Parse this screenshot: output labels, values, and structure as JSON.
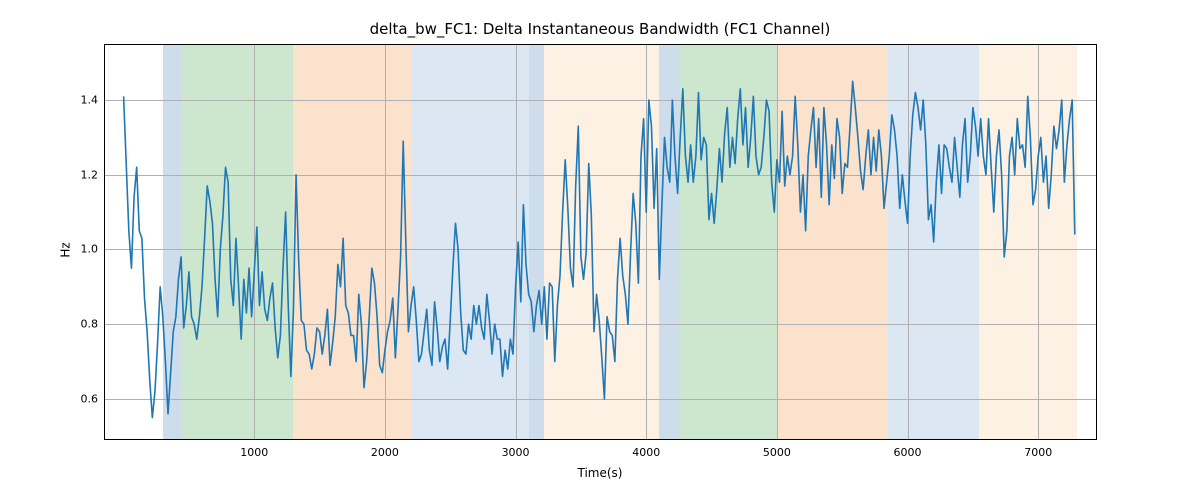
{
  "chart_data": {
    "type": "line",
    "title": "delta_bw_FC1: Delta Instantaneous Bandwidth (FC1 Channel)",
    "xlabel": "Time(s)",
    "ylabel": "Hz",
    "xlim": [
      -150,
      7450
    ],
    "ylim": [
      0.49,
      1.55
    ],
    "y_ticks": [
      0.6,
      0.8,
      1.0,
      1.2,
      1.4
    ],
    "x_ticks": [
      1000,
      2000,
      3000,
      4000,
      5000,
      6000,
      7000
    ],
    "regions": [
      {
        "start": 300,
        "end": 450,
        "color": "#6596c4"
      },
      {
        "start": 450,
        "end": 1300,
        "color": "#64b366"
      },
      {
        "start": 1300,
        "end": 2200,
        "color": "#f4a460"
      },
      {
        "start": 2200,
        "end": 3100,
        "color": "#8fb4d9"
      },
      {
        "start": 3100,
        "end": 3220,
        "color": "#6596c4"
      },
      {
        "start": 3220,
        "end": 4100,
        "color": "#f9d2a8"
      },
      {
        "start": 4100,
        "end": 4260,
        "color": "#6596c4"
      },
      {
        "start": 4260,
        "end": 5000,
        "color": "#64b366"
      },
      {
        "start": 5000,
        "end": 5850,
        "color": "#f4a460"
      },
      {
        "start": 5850,
        "end": 6550,
        "color": "#8fb4d9"
      },
      {
        "start": 6550,
        "end": 7300,
        "color": "#f9d2a8"
      }
    ],
    "x": [
      0,
      20,
      40,
      60,
      80,
      100,
      120,
      140,
      160,
      180,
      200,
      220,
      240,
      260,
      280,
      300,
      320,
      340,
      360,
      380,
      400,
      420,
      440,
      460,
      480,
      500,
      520,
      540,
      560,
      580,
      600,
      620,
      640,
      660,
      680,
      700,
      720,
      740,
      760,
      780,
      800,
      820,
      840,
      860,
      880,
      900,
      920,
      940,
      960,
      980,
      1000,
      1020,
      1040,
      1060,
      1080,
      1100,
      1120,
      1140,
      1160,
      1180,
      1200,
      1220,
      1240,
      1260,
      1280,
      1300,
      1320,
      1340,
      1360,
      1380,
      1400,
      1420,
      1440,
      1460,
      1480,
      1500,
      1520,
      1540,
      1560,
      1580,
      1600,
      1620,
      1640,
      1660,
      1680,
      1700,
      1720,
      1740,
      1760,
      1780,
      1800,
      1820,
      1840,
      1860,
      1880,
      1900,
      1920,
      1940,
      1960,
      1980,
      2000,
      2020,
      2040,
      2060,
      2080,
      2100,
      2120,
      2140,
      2160,
      2180,
      2200,
      2220,
      2240,
      2260,
      2280,
      2300,
      2320,
      2340,
      2360,
      2380,
      2400,
      2420,
      2440,
      2460,
      2480,
      2500,
      2520,
      2540,
      2560,
      2580,
      2600,
      2620,
      2640,
      2660,
      2680,
      2700,
      2720,
      2740,
      2760,
      2780,
      2800,
      2820,
      2840,
      2860,
      2880,
      2900,
      2920,
      2940,
      2960,
      2980,
      3000,
      3020,
      3040,
      3060,
      3080,
      3100,
      3120,
      3140,
      3160,
      3180,
      3200,
      3220,
      3240,
      3260,
      3280,
      3300,
      3320,
      3340,
      3360,
      3380,
      3400,
      3420,
      3440,
      3460,
      3480,
      3500,
      3520,
      3540,
      3560,
      3580,
      3600,
      3620,
      3640,
      3660,
      3680,
      3700,
      3720,
      3740,
      3760,
      3780,
      3800,
      3820,
      3840,
      3860,
      3880,
      3900,
      3920,
      3940,
      3960,
      3980,
      4000,
      4020,
      4040,
      4060,
      4080,
      4100,
      4120,
      4140,
      4160,
      4180,
      4200,
      4220,
      4240,
      4260,
      4280,
      4300,
      4320,
      4340,
      4360,
      4380,
      4400,
      4420,
      4440,
      4460,
      4480,
      4500,
      4520,
      4540,
      4560,
      4580,
      4600,
      4620,
      4640,
      4660,
      4680,
      4700,
      4720,
      4740,
      4760,
      4780,
      4800,
      4820,
      4840,
      4860,
      4880,
      4900,
      4920,
      4940,
      4960,
      4980,
      5000,
      5020,
      5040,
      5060,
      5080,
      5100,
      5120,
      5140,
      5160,
      5180,
      5200,
      5220,
      5240,
      5260,
      5280,
      5300,
      5320,
      5340,
      5360,
      5380,
      5400,
      5420,
      5440,
      5460,
      5480,
      5500,
      5520,
      5540,
      5560,
      5580,
      5600,
      5620,
      5640,
      5660,
      5680,
      5700,
      5720,
      5740,
      5760,
      5780,
      5800,
      5820,
      5840,
      5860,
      5880,
      5900,
      5920,
      5940,
      5960,
      5980,
      6000,
      6020,
      6040,
      6060,
      6080,
      6100,
      6120,
      6140,
      6160,
      6180,
      6200,
      6220,
      6240,
      6260,
      6280,
      6300,
      6320,
      6340,
      6360,
      6380,
      6400,
      6420,
      6440,
      6460,
      6480,
      6500,
      6520,
      6540,
      6560,
      6580,
      6600,
      6620,
      6640,
      6660,
      6680,
      6700,
      6720,
      6740,
      6760,
      6780,
      6800,
      6820,
      6840,
      6860,
      6880,
      6900,
      6920,
      6940,
      6960,
      6980,
      7000,
      7020,
      7040,
      7060,
      7080,
      7100,
      7120,
      7140,
      7160,
      7180,
      7200,
      7220,
      7240,
      7260,
      7280
    ],
    "values": [
      1.41,
      1.23,
      1.05,
      0.95,
      1.14,
      1.22,
      1.05,
      1.03,
      0.87,
      0.78,
      0.65,
      0.55,
      0.62,
      0.75,
      0.9,
      0.82,
      0.7,
      0.56,
      0.67,
      0.78,
      0.82,
      0.92,
      0.98,
      0.79,
      0.85,
      0.94,
      0.82,
      0.8,
      0.76,
      0.82,
      0.9,
      1.03,
      1.17,
      1.13,
      1.07,
      0.92,
      0.82,
      1.0,
      1.09,
      1.22,
      1.18,
      0.92,
      0.85,
      1.03,
      0.9,
      0.76,
      0.92,
      0.83,
      0.95,
      0.82,
      0.94,
      1.06,
      0.85,
      0.94,
      0.84,
      0.81,
      0.87,
      0.91,
      0.79,
      0.71,
      0.77,
      0.95,
      1.1,
      0.85,
      0.66,
      0.84,
      1.2,
      0.97,
      0.81,
      0.8,
      0.73,
      0.72,
      0.68,
      0.72,
      0.79,
      0.78,
      0.72,
      0.77,
      0.84,
      0.69,
      0.75,
      0.82,
      0.96,
      0.9,
      1.03,
      0.85,
      0.83,
      0.77,
      0.77,
      0.7,
      0.88,
      0.8,
      0.63,
      0.7,
      0.82,
      0.95,
      0.91,
      0.82,
      0.69,
      0.67,
      0.73,
      0.78,
      0.81,
      0.87,
      0.71,
      0.84,
      0.98,
      1.29,
      1.02,
      0.78,
      0.85,
      0.9,
      0.81,
      0.7,
      0.72,
      0.78,
      0.84,
      0.73,
      0.69,
      0.86,
      0.79,
      0.7,
      0.74,
      0.76,
      0.68,
      0.81,
      0.95,
      1.07,
      1.0,
      0.83,
      0.73,
      0.72,
      0.8,
      0.76,
      0.85,
      0.8,
      0.85,
      0.79,
      0.76,
      0.88,
      0.81,
      0.72,
      0.8,
      0.76,
      0.76,
      0.66,
      0.73,
      0.68,
      0.76,
      0.72,
      0.9,
      1.02,
      0.86,
      1.12,
      0.96,
      0.88,
      0.86,
      0.78,
      0.85,
      0.89,
      0.8,
      0.9,
      0.76,
      0.91,
      0.9,
      0.7,
      0.85,
      0.93,
      1.1,
      1.24,
      1.11,
      0.95,
      0.9,
      1.17,
      1.33,
      0.98,
      0.92,
      0.99,
      1.23,
      1.09,
      0.78,
      0.88,
      0.81,
      0.71,
      0.6,
      0.82,
      0.78,
      0.77,
      0.7,
      0.92,
      1.03,
      0.93,
      0.88,
      0.8,
      0.99,
      1.15,
      1.07,
      0.91,
      1.25,
      1.35,
      1.1,
      1.4,
      1.33,
      1.11,
      1.27,
      0.92,
      1.12,
      1.3,
      1.22,
      1.18,
      1.4,
      1.25,
      1.15,
      1.3,
      1.43,
      1.25,
      1.18,
      1.28,
      1.18,
      1.25,
      1.42,
      1.24,
      1.3,
      1.28,
      1.08,
      1.15,
      1.07,
      1.16,
      1.27,
      1.18,
      1.31,
      1.38,
      1.22,
      1.3,
      1.23,
      1.35,
      1.43,
      1.28,
      1.38,
      1.22,
      1.3,
      1.41,
      1.25,
      1.2,
      1.22,
      1.3,
      1.4,
      1.37,
      1.18,
      1.1,
      1.24,
      1.18,
      1.37,
      1.17,
      1.25,
      1.2,
      1.25,
      1.41,
      1.28,
      1.1,
      1.2,
      1.05,
      1.25,
      1.32,
      1.38,
      1.22,
      1.35,
      1.14,
      1.38,
      1.28,
      1.12,
      1.28,
      1.19,
      1.35,
      1.3,
      1.15,
      1.23,
      1.22,
      1.33,
      1.45,
      1.38,
      1.3,
      1.21,
      1.16,
      1.25,
      1.32,
      1.2,
      1.3,
      1.21,
      1.32,
      1.25,
      1.11,
      1.18,
      1.25,
      1.36,
      1.32,
      1.25,
      1.11,
      1.2,
      1.13,
      1.07,
      1.25,
      1.36,
      1.42,
      1.38,
      1.32,
      1.4,
      1.28,
      1.08,
      1.12,
      1.02,
      1.18,
      1.28,
      1.15,
      1.28,
      1.27,
      1.22,
      1.18,
      1.3,
      1.22,
      1.14,
      1.28,
      1.35,
      1.18,
      1.25,
      1.38,
      1.33,
      1.25,
      1.35,
      1.25,
      1.2,
      1.35,
      1.22,
      1.1,
      1.25,
      1.32,
      1.2,
      0.98,
      1.05,
      1.25,
      1.3,
      1.2,
      1.35,
      1.27,
      1.28,
      1.22,
      1.41,
      1.3,
      1.12,
      1.16,
      1.25,
      1.3,
      1.18,
      1.25,
      1.11,
      1.2,
      1.33,
      1.27,
      1.32,
      1.4,
      1.18,
      1.28,
      1.35,
      1.4,
      1.04
    ]
  }
}
